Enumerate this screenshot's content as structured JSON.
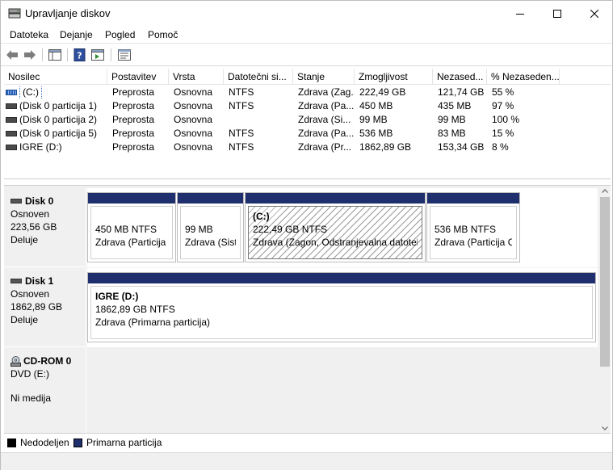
{
  "window": {
    "title": "Upravljanje diskov"
  },
  "menu": [
    "Datoteka",
    "Dejanje",
    "Pogled",
    "Pomoč"
  ],
  "list": {
    "headers": [
      "Nosilec",
      "Postavitev",
      "Vrsta",
      "Datotečni si...",
      "Stanje",
      "Zmogljivost",
      "Nezased...",
      "% Nezaseden..."
    ],
    "rows": [
      {
        "name": "(C:)",
        "layout": "Preprosta",
        "type": "Osnovna",
        "fs": "NTFS",
        "status": "Zdrava (Zag...",
        "capacity": "222,49 GB",
        "free": "121,74 GB",
        "pct": "55 %"
      },
      {
        "name": "(Disk 0 particija 1)",
        "layout": "Preprosta",
        "type": "Osnovna",
        "fs": "NTFS",
        "status": "Zdrava (Pa...",
        "capacity": "450 MB",
        "free": "435 MB",
        "pct": "97 %"
      },
      {
        "name": "(Disk 0 particija 2)",
        "layout": "Preprosta",
        "type": "Osnovna",
        "fs": "",
        "status": "Zdrava (Si...",
        "capacity": "99 MB",
        "free": "99 MB",
        "pct": "100 %"
      },
      {
        "name": "(Disk 0 particija 5)",
        "layout": "Preprosta",
        "type": "Osnovna",
        "fs": "NTFS",
        "status": "Zdrava (Pa...",
        "capacity": "536 MB",
        "free": "83 MB",
        "pct": "15 %"
      },
      {
        "name": "IGRE (D:)",
        "layout": "Preprosta",
        "type": "Osnovna",
        "fs": "NTFS",
        "status": "Zdrava (Pr...",
        "capacity": "1862,89 GB",
        "free": "153,34 GB",
        "pct": "8 %"
      }
    ]
  },
  "disks": [
    {
      "name": "Disk 0",
      "kind": "Osnoven",
      "size": "223,56 GB",
      "state": "Deluje",
      "partitions": [
        {
          "title": "",
          "line1": "450 MB NTFS",
          "line2": "Zdrava (Particija C"
        },
        {
          "title": "",
          "line1": "99 MB",
          "line2": "Zdrava (Siste"
        },
        {
          "title": "(C:)",
          "line1": "222,49 GB NTFS",
          "line2": "Zdrava (Zagon, Odstranjevalna datoteka"
        },
        {
          "title": "",
          "line1": "536 MB NTFS",
          "line2": "Zdrava (Particija OE"
        }
      ]
    },
    {
      "name": "Disk 1",
      "kind": "Osnoven",
      "size": "1862,89 GB",
      "state": "Deluje",
      "partitions": [
        {
          "title": "IGRE  (D:)",
          "line1": "1862,89 GB NTFS",
          "line2": "Zdrava (Primarna particija)"
        }
      ]
    },
    {
      "name": "CD-ROM 0",
      "kind": "DVD (E:)",
      "size": "",
      "state": "Ni medija"
    }
  ],
  "legend": [
    {
      "label": "Nedodeljen",
      "color": "#000000"
    },
    {
      "label": "Primarna particija",
      "color": "#1f2f6d"
    }
  ],
  "colors": {
    "partition_bar": "#1f2f6d",
    "selection": "#3d78c8"
  }
}
